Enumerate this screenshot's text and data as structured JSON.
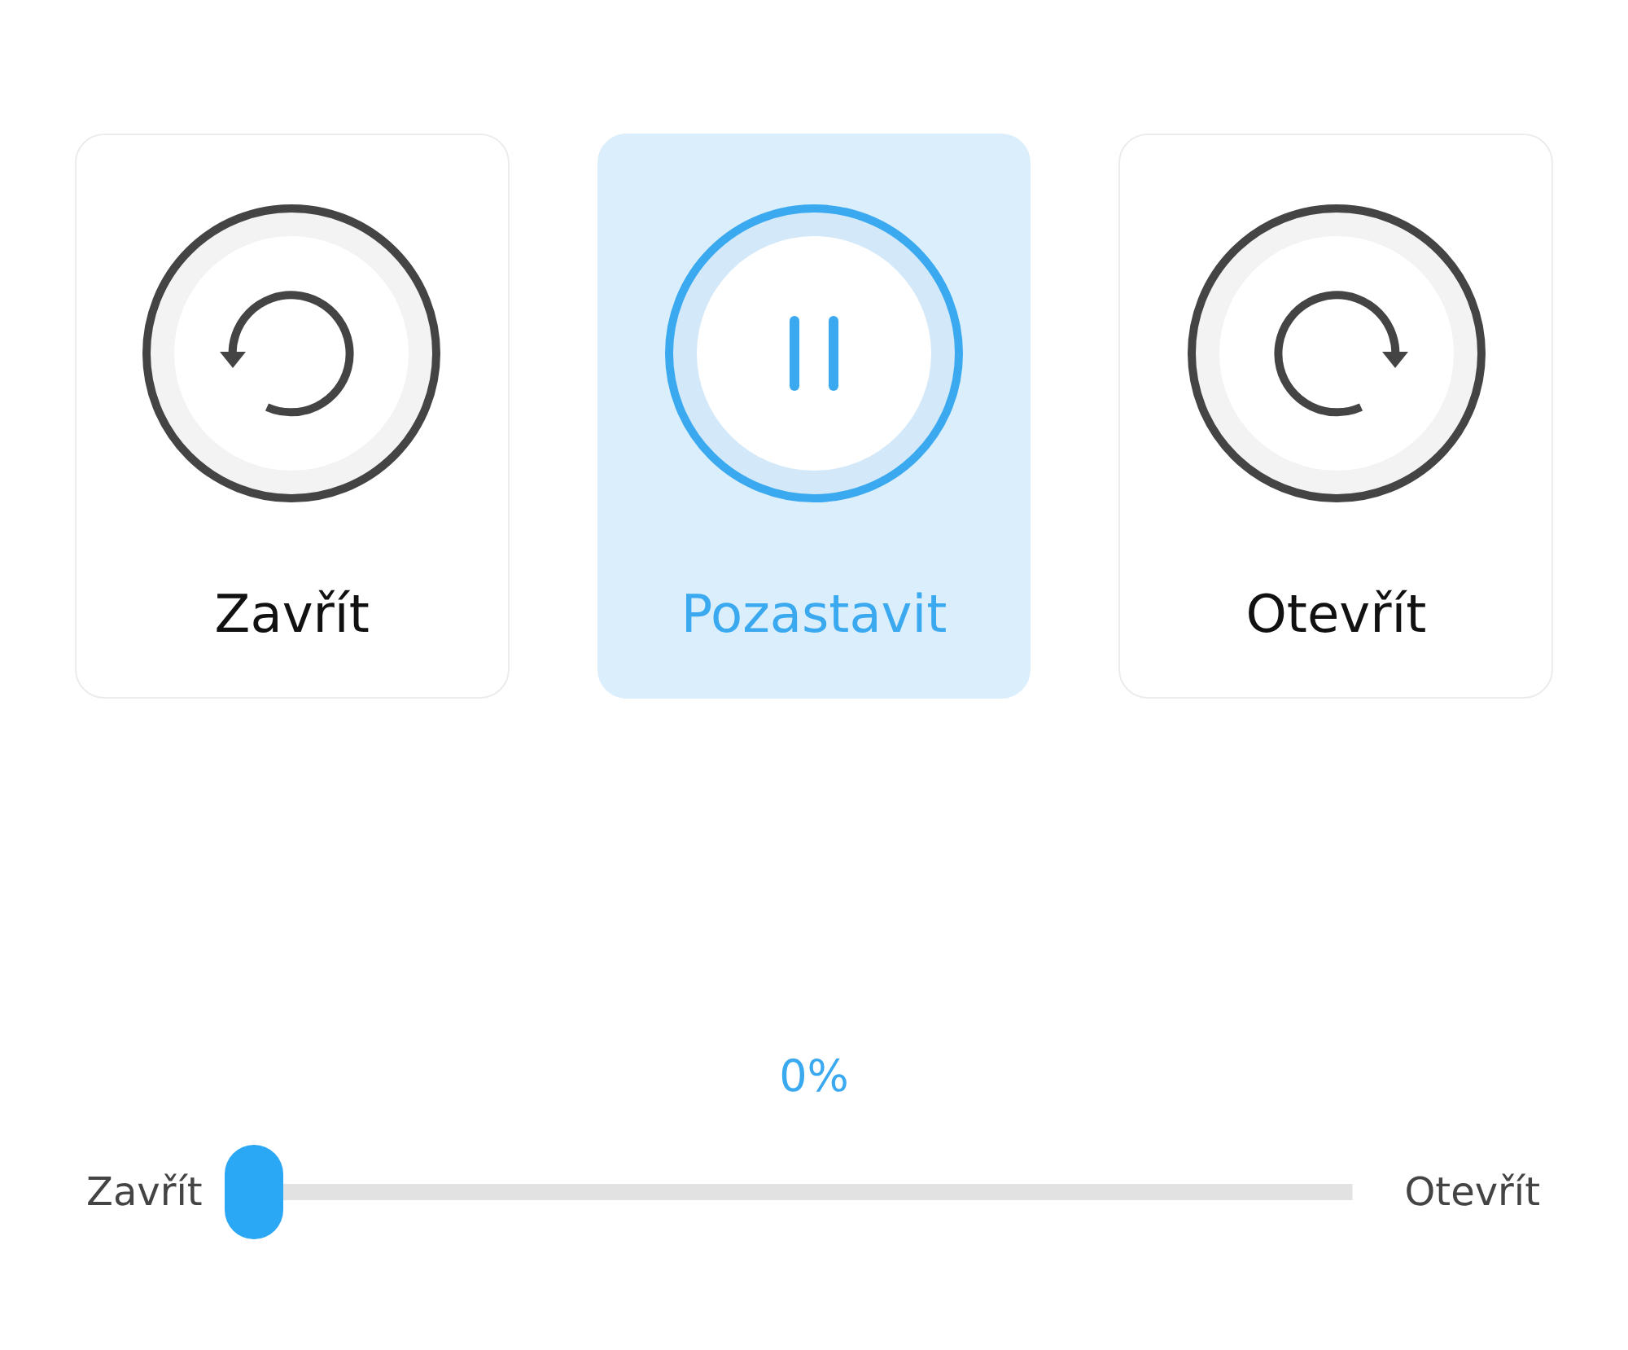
{
  "buttons": [
    {
      "label": "Zavřít",
      "kind": "close",
      "selected": false
    },
    {
      "label": "Pozastavit",
      "kind": "pause",
      "selected": true
    },
    {
      "label": "Otevřít",
      "kind": "open",
      "selected": false
    }
  ],
  "slider": {
    "reading": "0%",
    "level": 0,
    "min_label": "Zavřít",
    "max_label": "Otevřít"
  }
}
